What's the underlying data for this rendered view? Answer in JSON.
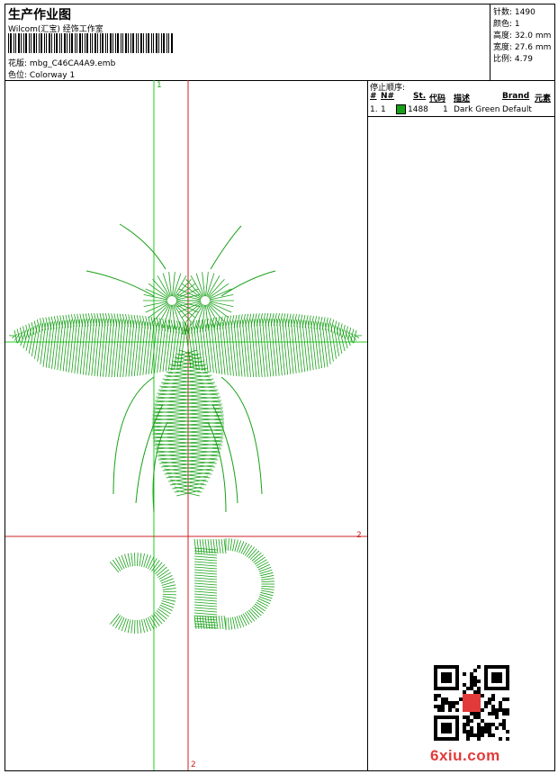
{
  "header": {
    "title": "生产作业图",
    "subtitle": "Wilcom(汇宝) 经饰工作室",
    "design_label": "花版:",
    "design_value": "mbg_C46CA4A9.emb",
    "colorway_label": "色位:",
    "colorway_value": "Colorway 1"
  },
  "stats": [
    {
      "label": "针数:",
      "value": "1490"
    },
    {
      "label": "颜色:",
      "value": "1"
    },
    {
      "label": "高度:",
      "value": "32.0 mm"
    },
    {
      "label": "宽度:",
      "value": "27.6 mm"
    },
    {
      "label": "比例:",
      "value": "4.79"
    }
  ],
  "guides": {
    "v_green_top": "1",
    "h_red_right": "2",
    "v_red_bottom": "2"
  },
  "stop_sequence": {
    "title": "停止顺序:",
    "columns": [
      "#",
      "N#",
      "St.",
      "代码",
      "描述",
      "Brand",
      "元素"
    ],
    "rows": [
      {
        "index": "1.",
        "needle": "1",
        "color": "#16a016",
        "stitches": "1488",
        "code": "1",
        "description": "Dark Green",
        "brand": "Default",
        "element": ""
      }
    ]
  },
  "colors": {
    "thread": "#16a016",
    "guide_green": "#22cc22",
    "guide_red": "#cc2222",
    "watermark": "#e23a3a"
  },
  "watermark": "6xiu.com"
}
